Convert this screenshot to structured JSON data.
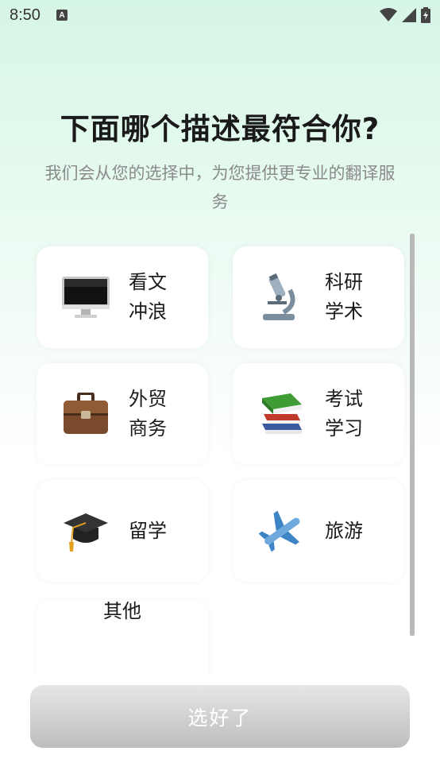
{
  "status_bar": {
    "time": "8:50",
    "notif_letter": "A"
  },
  "page": {
    "title": "下面哪个描述最符合你?",
    "subtitle": "我们会从您的选择中，为您提供更专业的翻译服务"
  },
  "options": [
    {
      "label": "看文冲浪",
      "icon": "computer-monitor-icon"
    },
    {
      "label": "科研学术",
      "icon": "microscope-icon"
    },
    {
      "label": "外贸商务",
      "icon": "briefcase-icon"
    },
    {
      "label": "考试学习",
      "icon": "books-icon"
    },
    {
      "label": "留学",
      "icon": "graduation-cap-icon"
    },
    {
      "label": "旅游",
      "icon": "airplane-icon"
    },
    {
      "label": "其他",
      "icon": ""
    }
  ],
  "confirm_button": {
    "label": "选好了"
  }
}
